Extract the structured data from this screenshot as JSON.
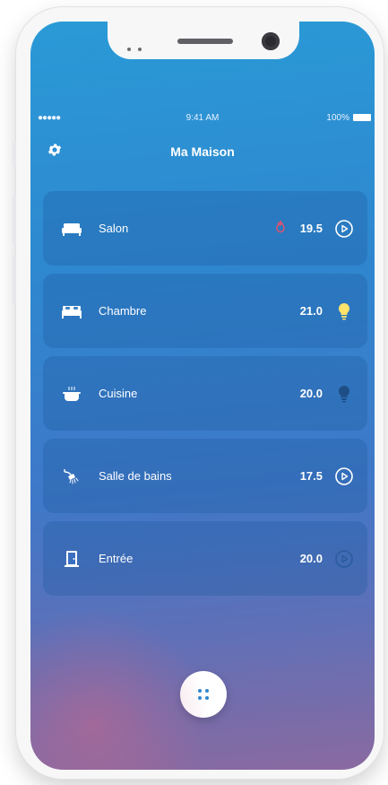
{
  "status": {
    "signal": "●●●●● ",
    "time": "9:41 AM",
    "battery": "100%"
  },
  "header": {
    "title": "Ma Maison",
    "settings_icon": "gear-icon"
  },
  "rooms": [
    {
      "name": "Salon",
      "temperature": "19.5",
      "icon": "sofa-icon",
      "heating": true,
      "status_icon": "play-circle-icon"
    },
    {
      "name": "Chambre",
      "temperature": "21.0",
      "icon": "bed-icon",
      "status_icon": "lightbulb-on-icon"
    },
    {
      "name": "Cuisine",
      "temperature": "20.0",
      "icon": "cooking-pot-icon",
      "status_icon": "lightbulb-off-icon"
    },
    {
      "name": "Salle de bains",
      "temperature": "17.5",
      "icon": "shower-icon",
      "status_icon": "play-circle-icon"
    },
    {
      "name": "Entrée",
      "temperature": "20.0",
      "icon": "door-icon",
      "status_icon": "play-circle-dim-icon"
    }
  ],
  "colors": {
    "accent": "#2f86cf",
    "flame": "#e8506a",
    "bulb_on": "#ffe36a",
    "bulb_off": "#1d4f86"
  },
  "fab_icon": "grid-dots-icon"
}
